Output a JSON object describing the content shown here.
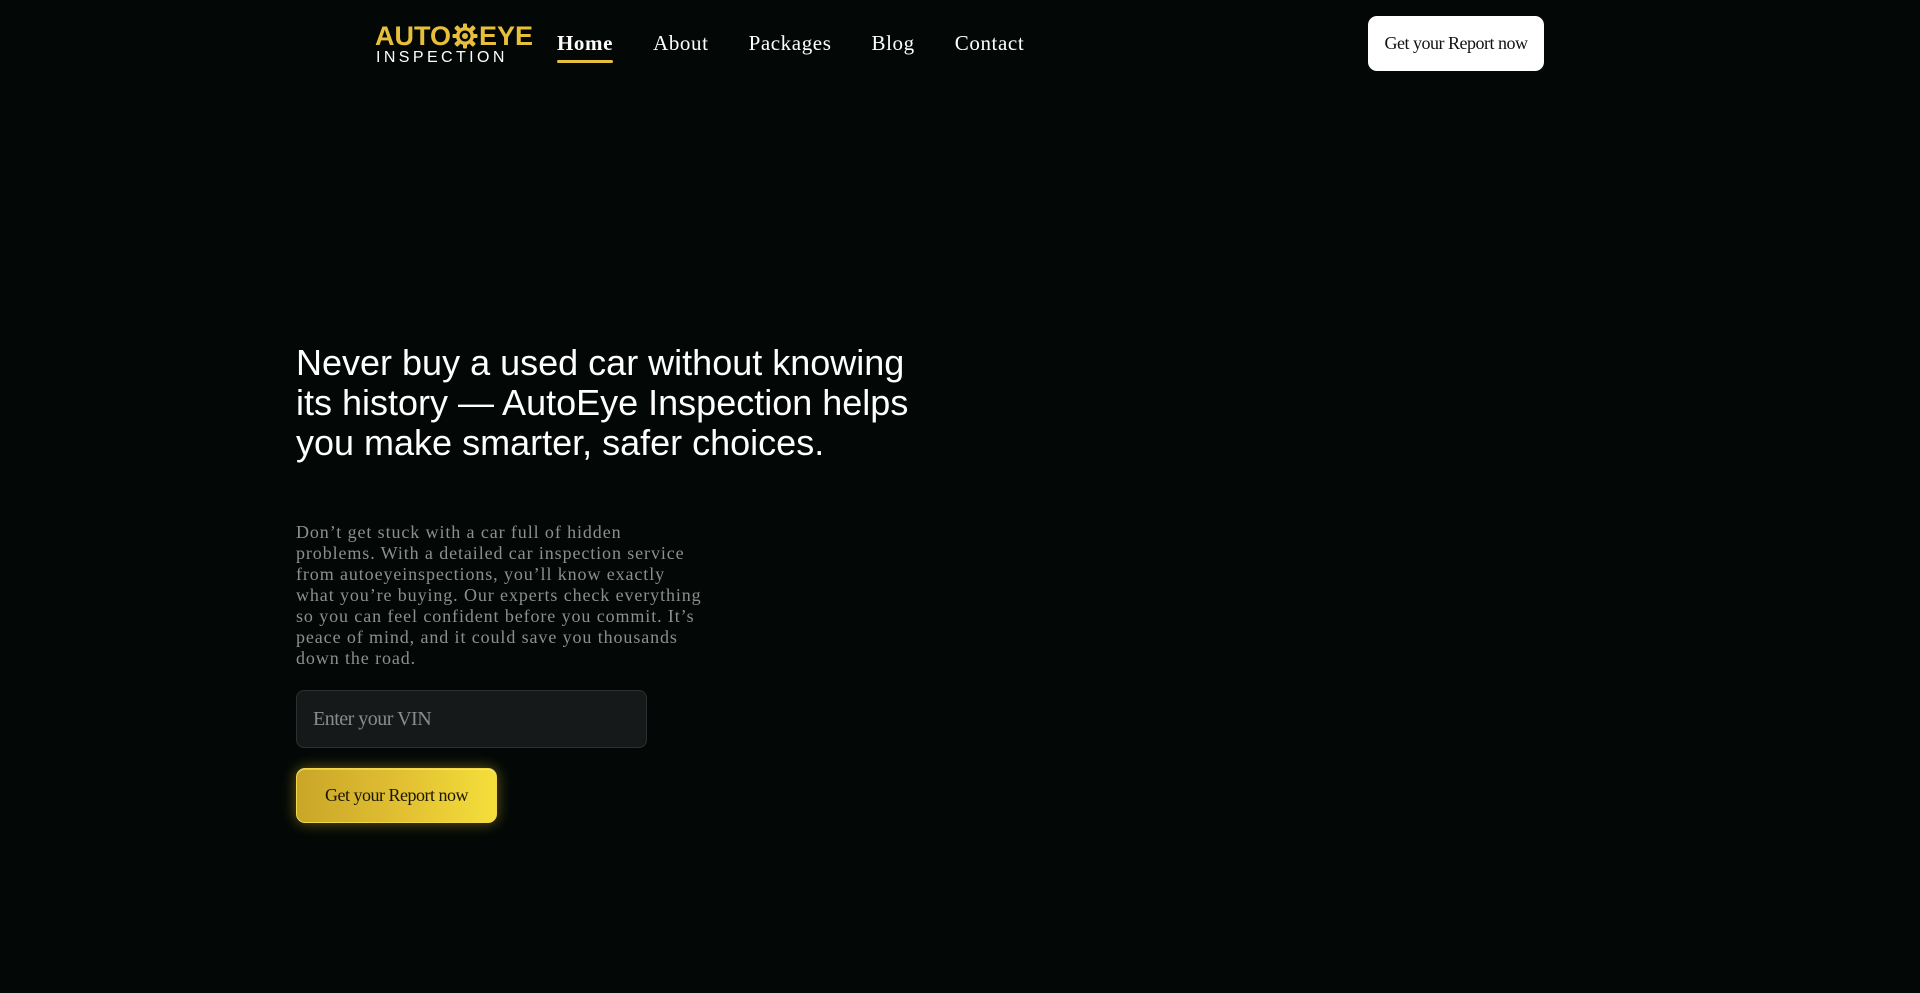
{
  "brand": {
    "logo_top_left": "AUTO",
    "logo_top_right": "EYE",
    "logo_bottom": "INSPECTION",
    "accent_color": "#e8bf3a"
  },
  "nav": {
    "items": [
      {
        "label": "Home",
        "active": true
      },
      {
        "label": "About",
        "active": false
      },
      {
        "label": "Packages",
        "active": false
      },
      {
        "label": "Blog",
        "active": false
      },
      {
        "label": "Contact",
        "active": false
      }
    ],
    "cta_label": "Get your Report now"
  },
  "hero": {
    "title": "Never buy a used car without knowing its history — AutoEye Inspection helps you make smarter, safer choices.",
    "description": "Don’t get stuck with a car full of hidden problems. With a detailed car inspection service from autoeyeinspections, you’ll know exactly what you’re buying. Our experts check everything so you can feel confident before you commit. It’s peace of mind, and it could save you thousands down the road.",
    "vin_placeholder": "Enter your VIN",
    "vin_value": "",
    "cta_label": "Get your Report now"
  },
  "colors": {
    "background": "#030807",
    "cta_gradient_start": "#c9a628",
    "cta_gradient_end": "#f4df3a"
  }
}
